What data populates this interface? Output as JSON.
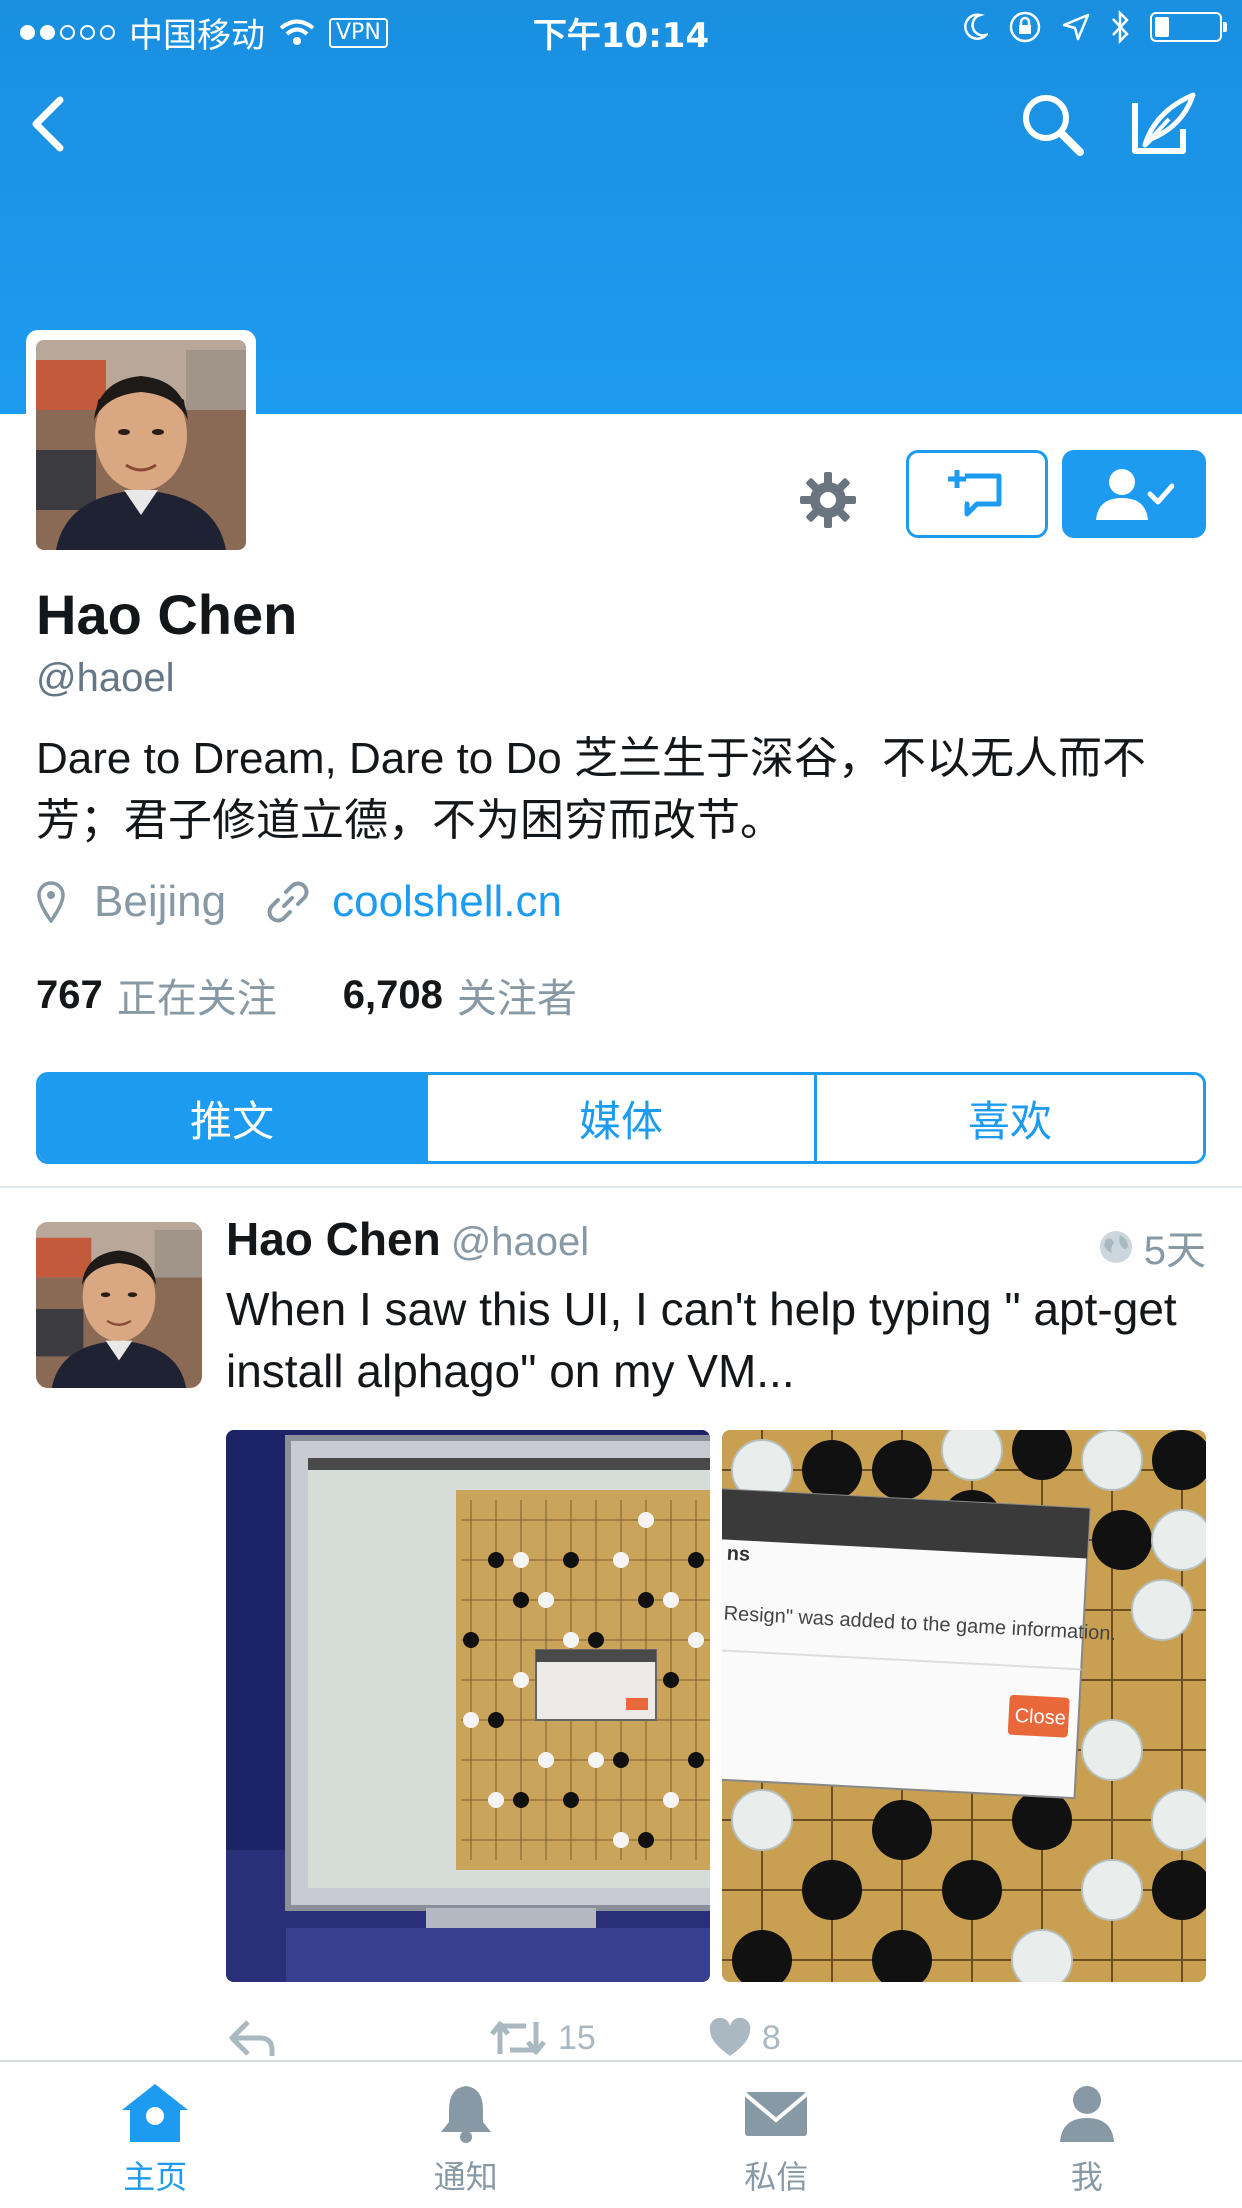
{
  "status_bar": {
    "carrier": "中国移动",
    "vpn": "VPN",
    "time": "下午10:14"
  },
  "profile": {
    "name": "Hao Chen",
    "handle": "@haoel",
    "bio": "Dare to Dream, Dare to Do 芝兰生于深谷，不以无人而不芳；君子修道立德，不为困穷而改节。",
    "location": "Beijing",
    "website": "coolshell.cn",
    "following_count": "767",
    "following_label": "正在关注",
    "followers_count": "6,708",
    "followers_label": "关注者"
  },
  "tabs": [
    {
      "label": "推文",
      "active": true
    },
    {
      "label": "媒体",
      "active": false
    },
    {
      "label": "喜欢",
      "active": false
    }
  ],
  "tweet": {
    "name": "Hao Chen",
    "handle": "@haoel",
    "time": "5天",
    "text": "When I saw this UI, I can't help typing \" apt-get install alphago\" on my VM...",
    "retweets": "15",
    "likes": "8",
    "media_dialog_text": "Resign\" was added to the game information.",
    "media_dialog_title": "ns",
    "media_close_label": "Close"
  },
  "bottom_tabs": [
    {
      "label": "主页",
      "icon": "home-icon",
      "active": true
    },
    {
      "label": "通知",
      "icon": "bell-icon",
      "active": false
    },
    {
      "label": "私信",
      "icon": "envelope-icon",
      "active": false
    },
    {
      "label": "我",
      "icon": "person-icon",
      "active": false
    }
  ],
  "colors": {
    "brand_blue": "#1d9bf0",
    "text_primary": "#14171a",
    "text_secondary": "#8899a6"
  }
}
